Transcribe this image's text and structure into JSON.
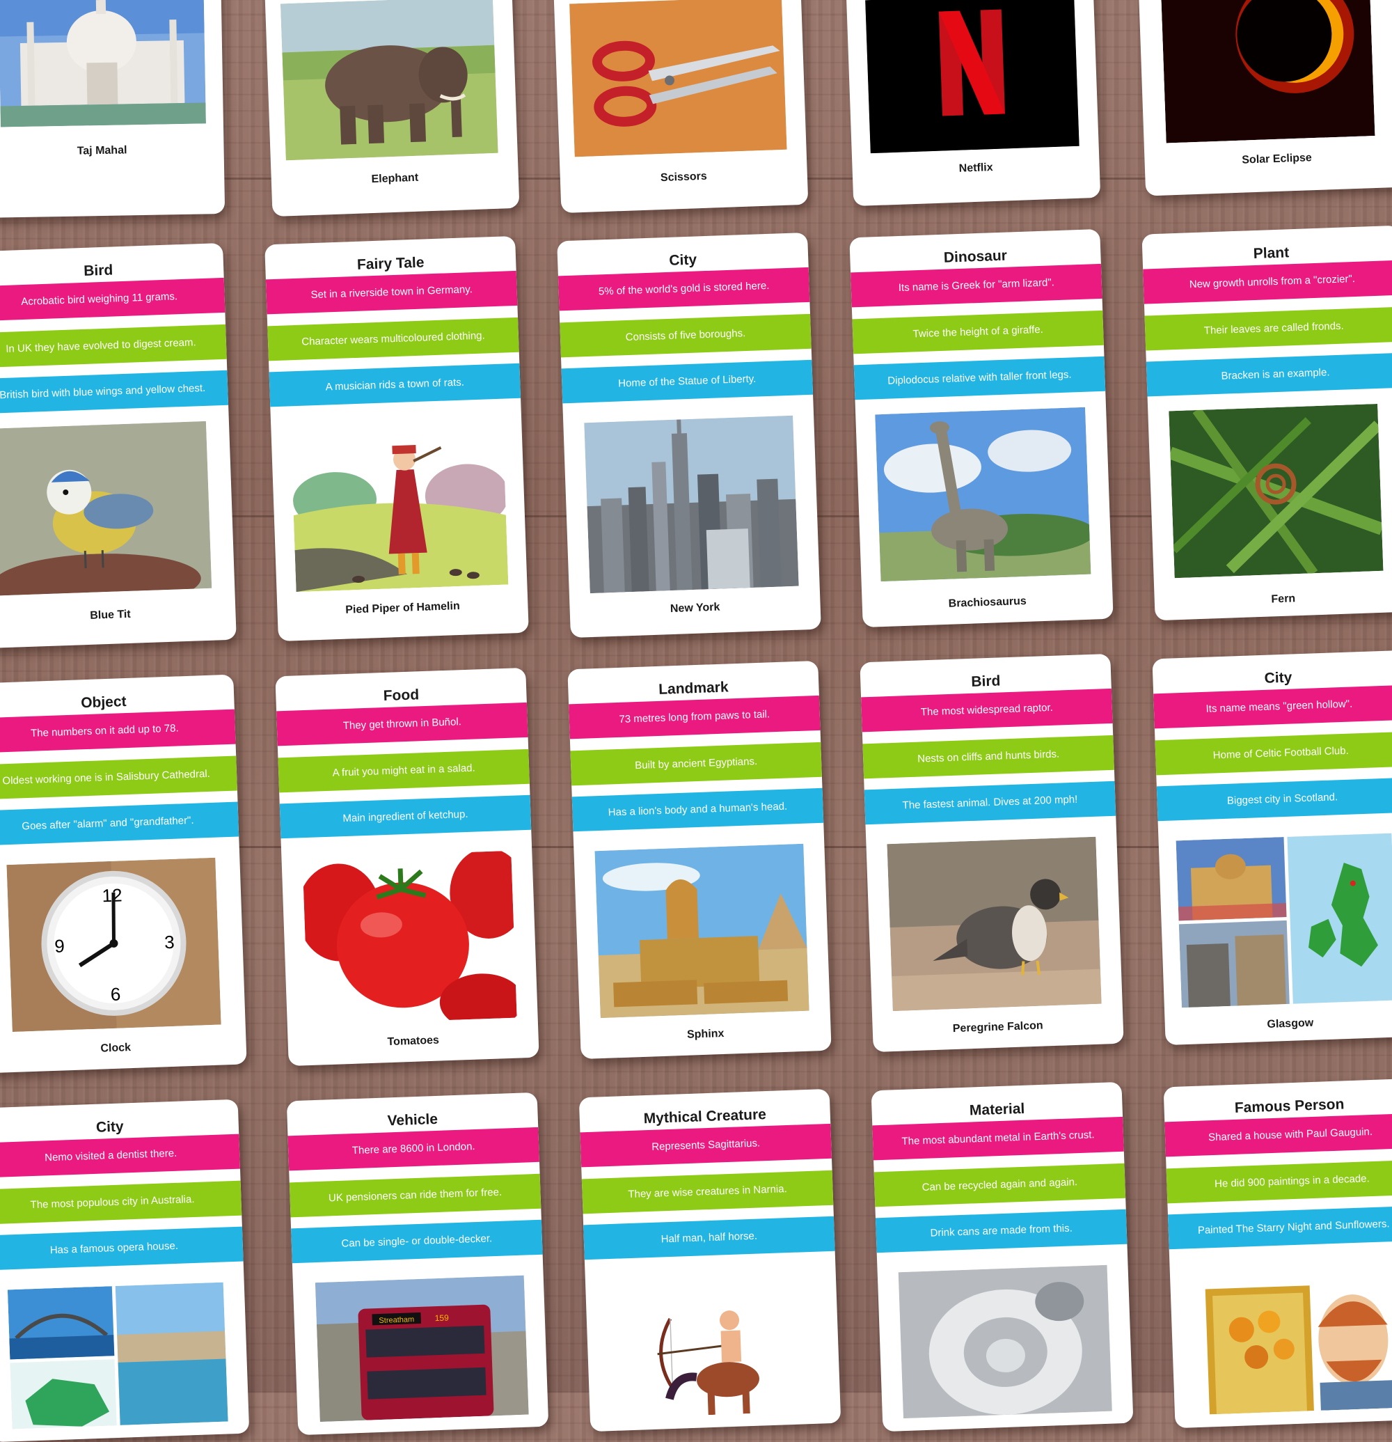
{
  "colors": {
    "table": "#8e6a60",
    "clue_first": "#ea1a80",
    "clue_second": "#8dcb16",
    "clue_third": "#22b5e4"
  },
  "top_row": [
    {
      "answer": "Taj Mahal",
      "image": "taj-mahal-photo"
    },
    {
      "answer": "Elephant",
      "image": "elephant-photo"
    },
    {
      "answer": "Scissors",
      "image": "scissors-photo"
    },
    {
      "answer": "Netflix",
      "image": "netflix-logo"
    },
    {
      "answer": "Solar Eclipse",
      "image": "solar-eclipse-photo"
    }
  ],
  "row2": [
    {
      "category": "Bird",
      "clues": [
        "Acrobatic bird weighing 11 grams.",
        "In UK they have evolved to digest cream.",
        "British bird with blue wings and yellow chest."
      ],
      "answer": "Blue Tit",
      "image": "blue-tit-photo"
    },
    {
      "category": "Fairy Tale",
      "clues": [
        "Set in a riverside town in Germany.",
        "Character wears multicoloured clothing.",
        "A musician rids a town of rats."
      ],
      "answer": "Pied Piper of Hamelin",
      "image": "pied-piper-illustration"
    },
    {
      "category": "City",
      "clues": [
        "5% of the world's gold is stored here.",
        "Consists of five boroughs.",
        "Home of the Statue of Liberty."
      ],
      "answer": "New York",
      "image": "new-york-skyline-photo"
    },
    {
      "category": "Dinosaur",
      "clues": [
        "Its name is Greek for \"arm lizard\".",
        "Twice the height of a giraffe.",
        "Diplodocus relative with taller front legs."
      ],
      "answer": "Brachiosaurus",
      "image": "brachiosaurus-illustration"
    },
    {
      "category": "Plant",
      "clues": [
        "New growth unrolls from a \"crozier\".",
        "Their leaves are called fronds.",
        "Bracken is an example."
      ],
      "answer": "Fern",
      "image": "fern-photo"
    }
  ],
  "row3": [
    {
      "category": "Object",
      "clues": [
        "The numbers on it add up to 78.",
        "Oldest working one is in Salisbury Cathedral.",
        "Goes after \"alarm\" and \"grandfather\"."
      ],
      "answer": "Clock",
      "image": "clock-photo"
    },
    {
      "category": "Food",
      "clues": [
        "They get thrown in Buñol.",
        "A fruit you might eat in a salad.",
        "Main ingredient of ketchup."
      ],
      "answer": "Tomatoes",
      "image": "tomatoes-photo"
    },
    {
      "category": "Landmark",
      "clues": [
        "73 metres long from paws to tail.",
        "Built by ancient Egyptians.",
        "Has a lion's body and a human's head."
      ],
      "answer": "Sphinx",
      "image": "sphinx-photo"
    },
    {
      "category": "Bird",
      "clues": [
        "The most widespread raptor.",
        "Nests on cliffs and hunts birds.",
        "The fastest animal. Dives at 200 mph!"
      ],
      "answer": "Peregrine Falcon",
      "image": "peregrine-falcon-photo"
    },
    {
      "category": "City",
      "clues": [
        "Its name means \"green hollow\".",
        "Home of Celtic Football Club.",
        "Biggest city in Scotland."
      ],
      "answer": "Glasgow",
      "image": "glasgow-collage"
    }
  ],
  "row4": [
    {
      "category": "City",
      "clues": [
        "Nemo visited a dentist there.",
        "The most populous city in Australia.",
        "Has a famous opera house."
      ],
      "image": "sydney-collage"
    },
    {
      "category": "Vehicle",
      "clues": [
        "There are 8600 in London.",
        "UK pensioners can ride them for free.",
        "Can be single- or double-decker."
      ],
      "image": "double-decker-bus-photo",
      "bus_sign": "Streatham",
      "bus_number": "159"
    },
    {
      "category": "Mythical Creature",
      "clues": [
        "Represents Sagittarius.",
        "They are wise creatures in Narnia.",
        "Half man, half horse."
      ],
      "image": "centaur-illustration"
    },
    {
      "category": "Material",
      "clues": [
        "The most abundant metal in Earth's crust.",
        "Can be recycled again and again.",
        "Drink cans are made from this."
      ],
      "image": "aluminium-can-photo"
    },
    {
      "category": "Famous Person",
      "clues": [
        "Shared a house with Paul Gauguin.",
        "He did 900 paintings in a decade.",
        "Painted The Starry Night and Sunflowers."
      ],
      "image": "van-gogh-illustration"
    }
  ]
}
